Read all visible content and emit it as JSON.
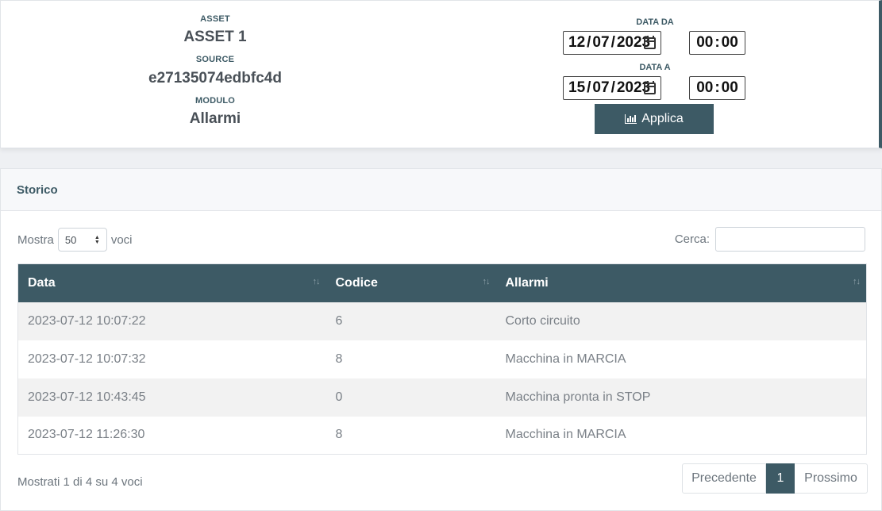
{
  "header": {
    "asset_label": "ASSET",
    "asset_value": "ASSET 1",
    "source_label": "SOURCE",
    "source_value": "e27135074edbfc4d",
    "module_label": "MODULO",
    "module_value": "Allarmi"
  },
  "date_filter": {
    "from_label": "DATA DA",
    "from_day": "12",
    "from_month": "07",
    "from_year": "2023",
    "from_hour": "00",
    "from_minute": "00",
    "to_label": "DATA A",
    "to_day": "15",
    "to_month": "07",
    "to_year": "2023",
    "to_hour": "00",
    "to_minute": "00",
    "date_sep": "/",
    "time_sep": ":",
    "apply_label": "Applica",
    "apply_icon": "bar-chart-icon"
  },
  "card": {
    "title": "Storico",
    "length_prefix": "Mostra",
    "length_value": "50",
    "length_suffix": "voci",
    "search_label": "Cerca:",
    "search_value": ""
  },
  "table": {
    "columns": [
      "Data",
      "Codice",
      "Allarmi"
    ],
    "rows": [
      [
        "2023-07-12 10:07:22",
        "6",
        "Corto circuito"
      ],
      [
        "2023-07-12 10:07:32",
        "8",
        "Macchina in MARCIA"
      ],
      [
        "2023-07-12 10:43:45",
        "0",
        "Macchina pronta in STOP"
      ],
      [
        "2023-07-12 11:26:30",
        "8",
        "Macchina in MARCIA"
      ]
    ]
  },
  "footer": {
    "info": "Mostrati 1 di 4 su 4 voci",
    "prev_label": "Precedente",
    "current_page": "1",
    "next_label": "Prossimo"
  },
  "colors": {
    "accent": "#3d5a65",
    "row_alt": "#f2f2f2"
  }
}
